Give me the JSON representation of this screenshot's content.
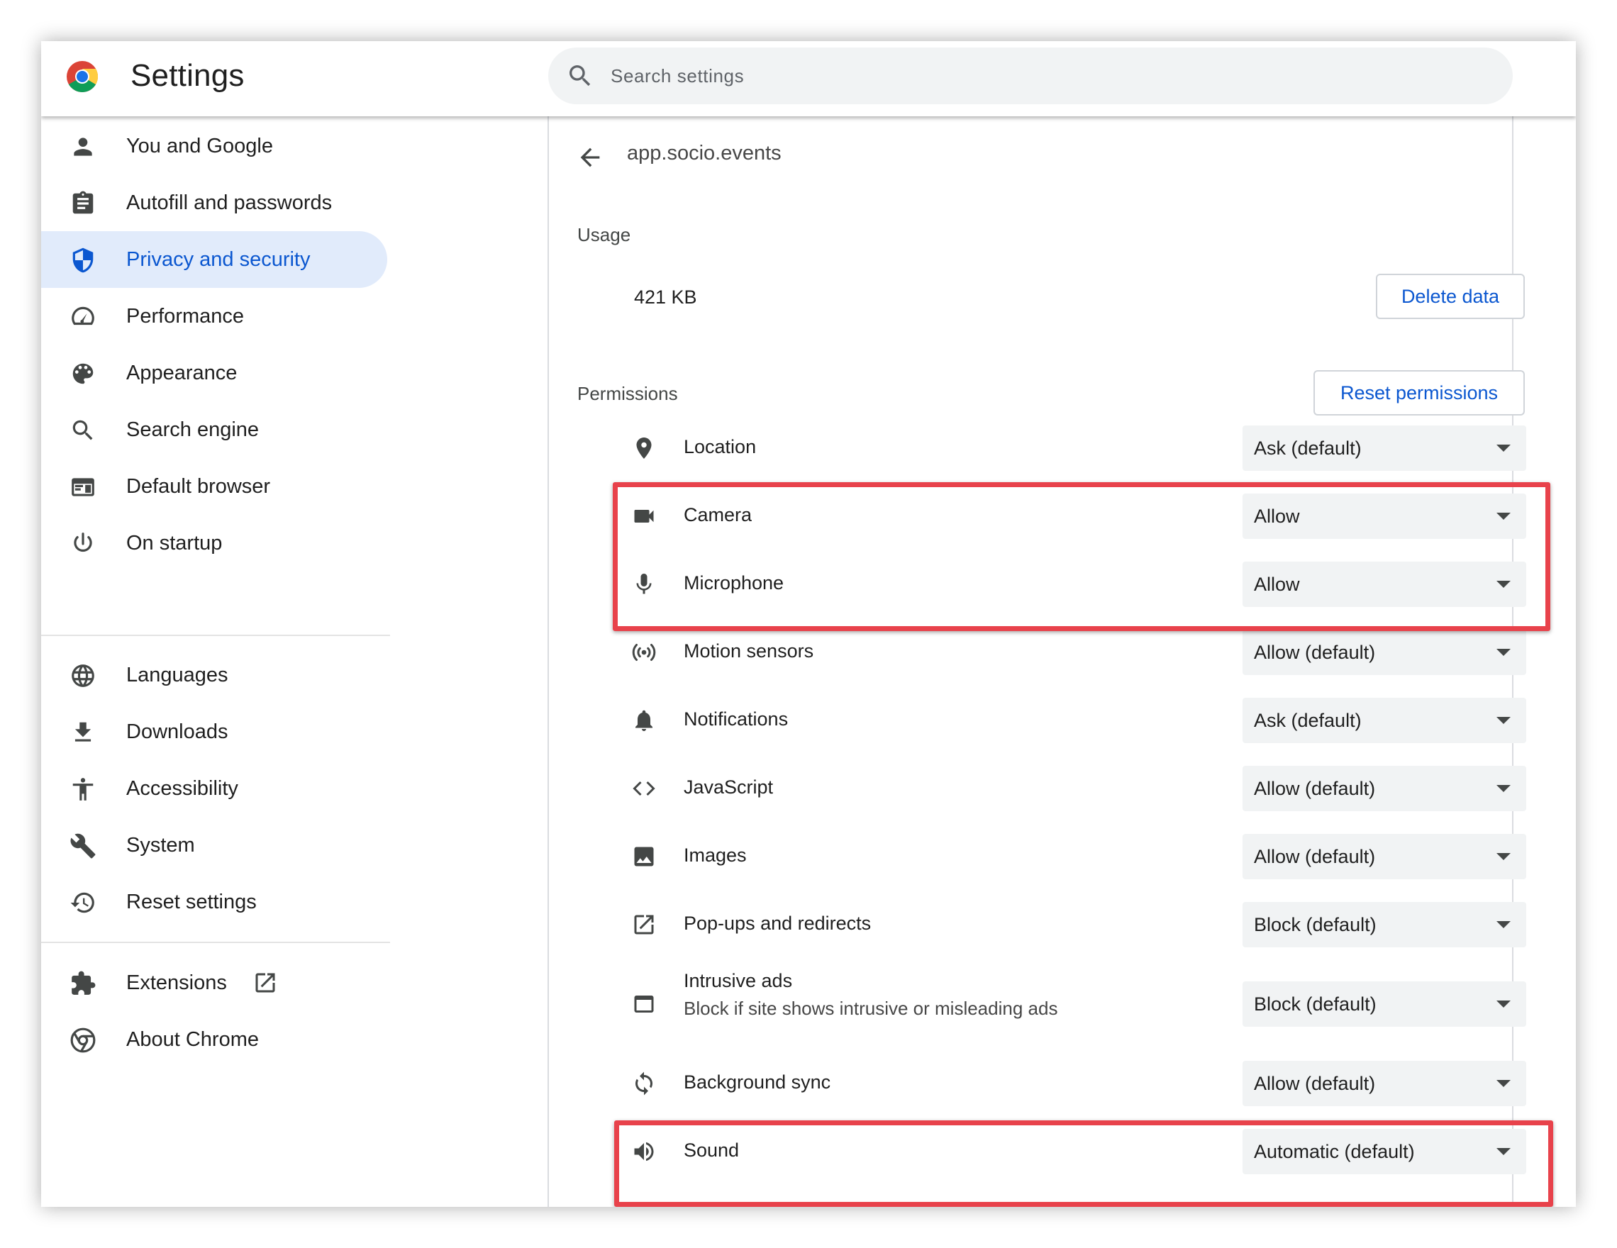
{
  "header": {
    "title": "Settings",
    "search_placeholder": "Search settings",
    "search_value": ""
  },
  "sidebar": {
    "items": [
      {
        "label": "You and Google",
        "icon": "person-icon"
      },
      {
        "label": "Autofill and passwords",
        "icon": "clipboard-icon"
      },
      {
        "label": "Privacy and security",
        "icon": "shield-icon",
        "active": true
      },
      {
        "label": "Performance",
        "icon": "speedometer-icon"
      },
      {
        "label": "Appearance",
        "icon": "palette-icon"
      },
      {
        "label": "Search engine",
        "icon": "search-icon"
      },
      {
        "label": "Default browser",
        "icon": "browser-icon"
      },
      {
        "label": "On startup",
        "icon": "power-icon"
      },
      {
        "label": "Languages",
        "icon": "globe-icon"
      },
      {
        "label": "Downloads",
        "icon": "download-icon"
      },
      {
        "label": "Accessibility",
        "icon": "accessibility-icon"
      },
      {
        "label": "System",
        "icon": "wrench-icon"
      },
      {
        "label": "Reset settings",
        "icon": "history-icon"
      },
      {
        "label": "Extensions",
        "icon": "puzzle-icon",
        "external": "open-in-new-icon"
      },
      {
        "label": "About Chrome",
        "icon": "chrome-icon"
      }
    ]
  },
  "site": {
    "name": "app.socio.events",
    "usage_heading": "Usage",
    "usage_value": "421 KB",
    "delete_data_label": "Delete data",
    "permissions_heading": "Permissions",
    "reset_permissions_label": "Reset permissions"
  },
  "permissions": [
    {
      "label": "Location",
      "icon": "location-pin-icon",
      "value": "Ask (default)"
    },
    {
      "label": "Camera",
      "icon": "camera-icon",
      "value": "Allow"
    },
    {
      "label": "Microphone",
      "icon": "microphone-icon",
      "value": "Allow"
    },
    {
      "label": "Motion sensors",
      "icon": "sensors-icon",
      "value": "Allow (default)"
    },
    {
      "label": "Notifications",
      "icon": "bell-icon",
      "value": "Ask (default)"
    },
    {
      "label": "JavaScript",
      "icon": "code-icon",
      "value": "Allow (default)"
    },
    {
      "label": "Images",
      "icon": "image-icon",
      "value": "Allow (default)"
    },
    {
      "label": "Pop-ups and redirects",
      "icon": "open-in-new-icon",
      "value": "Block (default)"
    },
    {
      "label": "Intrusive ads",
      "sublabel": "Block if site shows intrusive or misleading ads",
      "icon": "window-icon",
      "value": "Block (default)"
    },
    {
      "label": "Background sync",
      "icon": "sync-icon",
      "value": "Allow (default)"
    },
    {
      "label": "Sound",
      "icon": "speaker-icon",
      "value": "Automatic (default)"
    }
  ],
  "colors": {
    "accent": "#0b57d0",
    "active_nav_bg": "#e1ebfb",
    "highlight": "#e8424b",
    "select_bg": "#f1f3f4"
  }
}
